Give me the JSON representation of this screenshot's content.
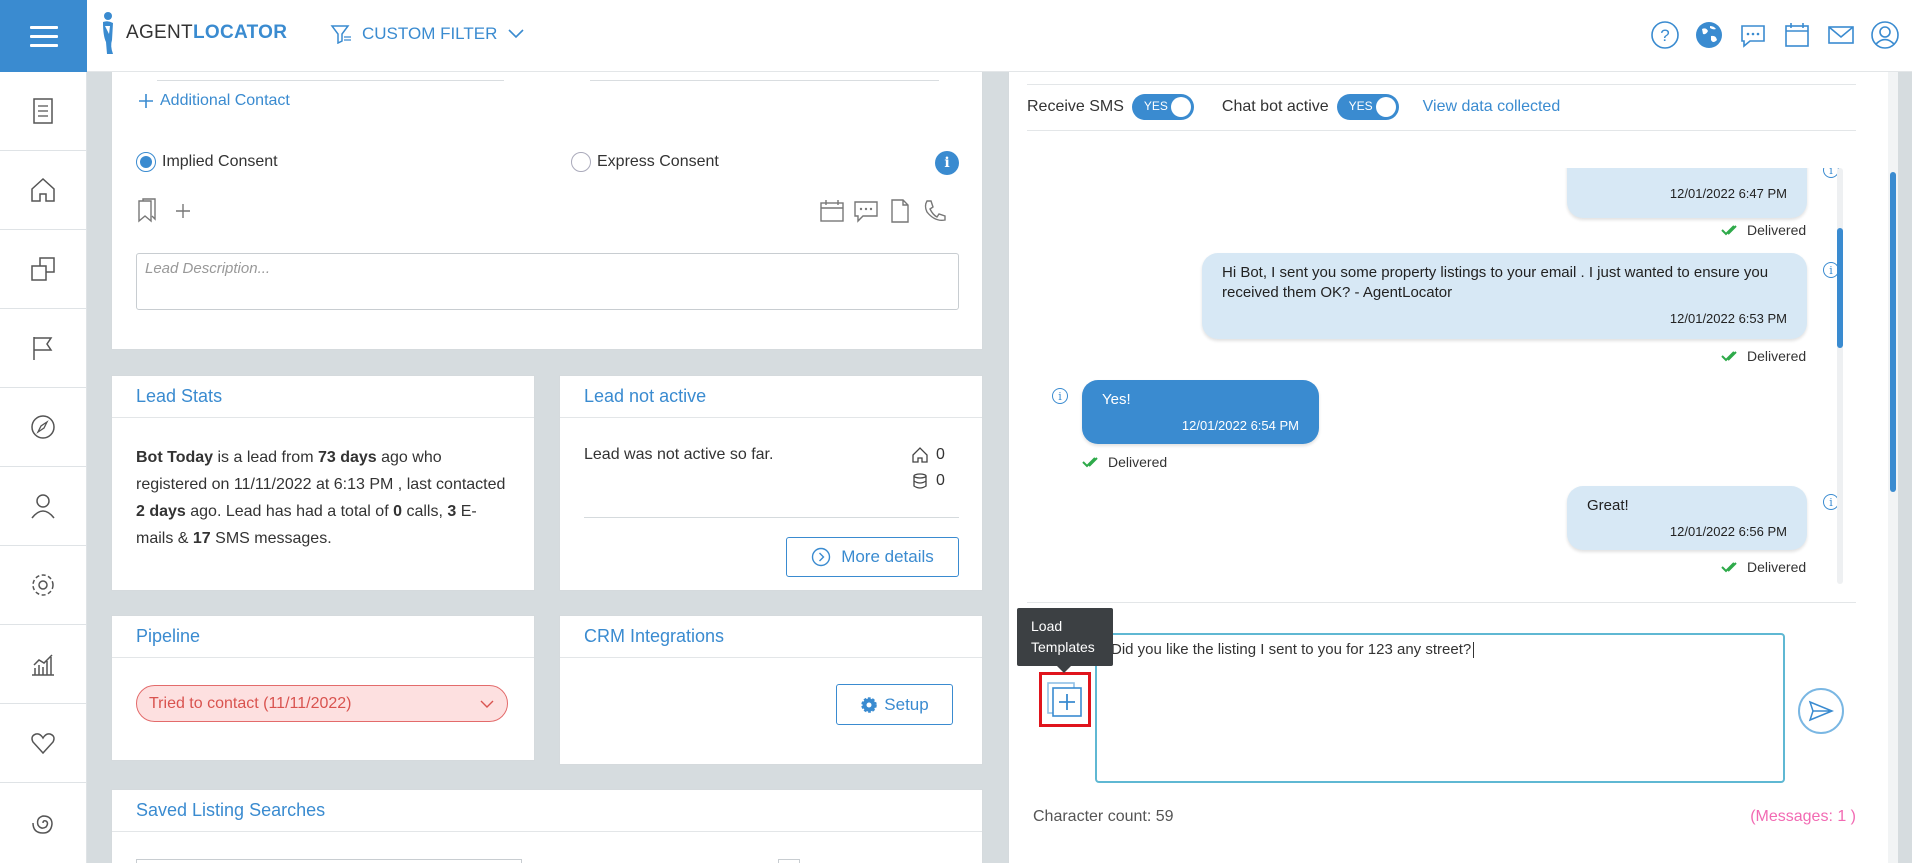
{
  "header": {
    "logo_part1": "AGENT",
    "logo_part2": "LOCATOR",
    "custom_filter_label": "CUSTOM FILTER"
  },
  "contact": {
    "additional_contact": "Additional Contact",
    "implied_consent": "Implied Consent",
    "express_consent": "Express Consent",
    "info_glyph": "i",
    "lead_description_placeholder": "Lead Description..."
  },
  "lead_stats": {
    "title": "Lead Stats",
    "t1": "Bot Today",
    "t2": " is a lead from ",
    "days": "73 days",
    "t3": " ago who registered on 11/11/2022 at 6:13 PM , last contacted ",
    "last_contacted": "2 days",
    "t4": " ago. Lead has had a total of ",
    "calls": "0",
    "t5": " calls, ",
    "emails": "3",
    "t6": " E-mails & ",
    "sms": "17",
    "t7": " SMS messages."
  },
  "lead_not_active": {
    "title": "Lead not active",
    "text": "Lead was not active so far.",
    "home_count": "0",
    "db_count": "0",
    "more_details": "More details"
  },
  "pipeline": {
    "title": "Pipeline",
    "selected": "Tried to contact (11/11/2022)"
  },
  "crm": {
    "title": "CRM Integrations",
    "setup": "Setup"
  },
  "saved_searches": {
    "title": "Saved Listing Searches"
  },
  "sms_panel": {
    "receive_sms": "Receive SMS",
    "receive_toggle": "YES",
    "chat_bot": "Chat bot active",
    "chat_toggle": "YES",
    "view_data": "View data collected",
    "messages": [
      {
        "direction": "out",
        "text": "",
        "time": "12/01/2022 6:47 PM",
        "status": "Delivered"
      },
      {
        "direction": "out",
        "text": "Hi Bot, I sent you some property listings to your email . I just wanted to ensure you received them OK? - AgentLocator",
        "time": "12/01/2022 6:53 PM",
        "status": "Delivered"
      },
      {
        "direction": "in",
        "text": "Yes!",
        "time": "12/01/2022 6:54 PM",
        "status": "Delivered"
      },
      {
        "direction": "out",
        "text": "Great!",
        "time": "12/01/2022 6:56 PM",
        "status": "Delivered"
      }
    ],
    "tooltip": "Load Templates",
    "input_value": "Did you like the listing I sent to you for 123 any street?",
    "character_count": "Character count: 59",
    "message_count": "(Messages: 1 )"
  },
  "colors": {
    "primary": "#3a8bd0",
    "pipeline_bg": "#fde0e0",
    "highlight_border": "#e0141c",
    "message_count": "#f26ab3"
  },
  "icons": {
    "topbar": [
      "help-icon",
      "globe-icon",
      "chat-icon",
      "calendar-icon",
      "mail-icon",
      "user-icon"
    ],
    "sidebar": [
      "document-icon",
      "home-icon",
      "copy-icon",
      "flag-icon",
      "compass-icon",
      "person-icon",
      "settings-icon",
      "analytics-icon",
      "heart-icon",
      "spiral-icon"
    ]
  }
}
